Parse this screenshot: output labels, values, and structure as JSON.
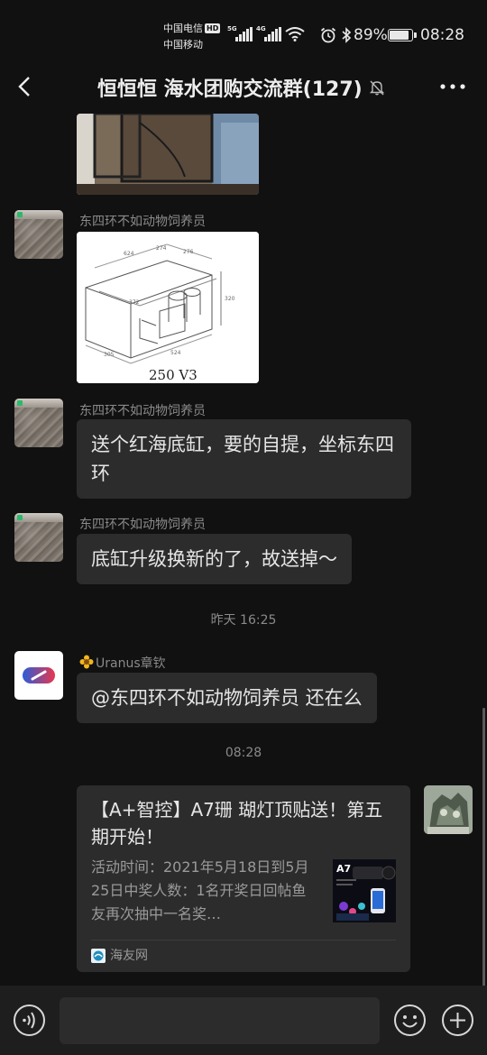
{
  "status_bar": {
    "carrier_1": "中国电信",
    "carrier_1_badge": "HD",
    "carrier_2": "中国移动",
    "sig_1": "5G",
    "sig_2": "4G",
    "battery_text": "89%",
    "battery_level": 0.89,
    "time": "08:28"
  },
  "header": {
    "title": "恒恒恒  海水团购交流群(127)",
    "icons": [
      "back-icon",
      "mute-bell-icon",
      "more-icon"
    ]
  },
  "messages": {
    "m1": {
      "sender": "东四环不如动物饲养员",
      "image_caption": "250 V3"
    },
    "m2": {
      "sender": "东四环不如动物饲养员",
      "text": "送个红海底缸，要的自提，坐标东四环"
    },
    "m3": {
      "sender": "东四环不如动物饲养员",
      "text": "底缸升级换新的了，故送掉～"
    },
    "time_1": "昨天 16:25",
    "m4": {
      "sender": "Uranus章钦",
      "text": "@东四环不如动物饲养员  还在么"
    },
    "time_2": "08:28",
    "card": {
      "title": "【A+智控】A7珊 瑚灯顶贴送！第五期开始！",
      "description": "活动时间：2021年5月18日到5月25日中奖人数：1名开奖日回帖鱼友再次抽中一名奖…",
      "thumb_label": "A7",
      "source": "海友网"
    }
  },
  "input_bar": {
    "placeholder": "",
    "icons": [
      "voice-icon",
      "emoji-icon",
      "plus-icon"
    ]
  },
  "colors": {
    "background": "#111111",
    "bubble": "#2c2c2c",
    "input_bar": "#1e1e1e",
    "secondary_text": "#8a8a8a"
  }
}
